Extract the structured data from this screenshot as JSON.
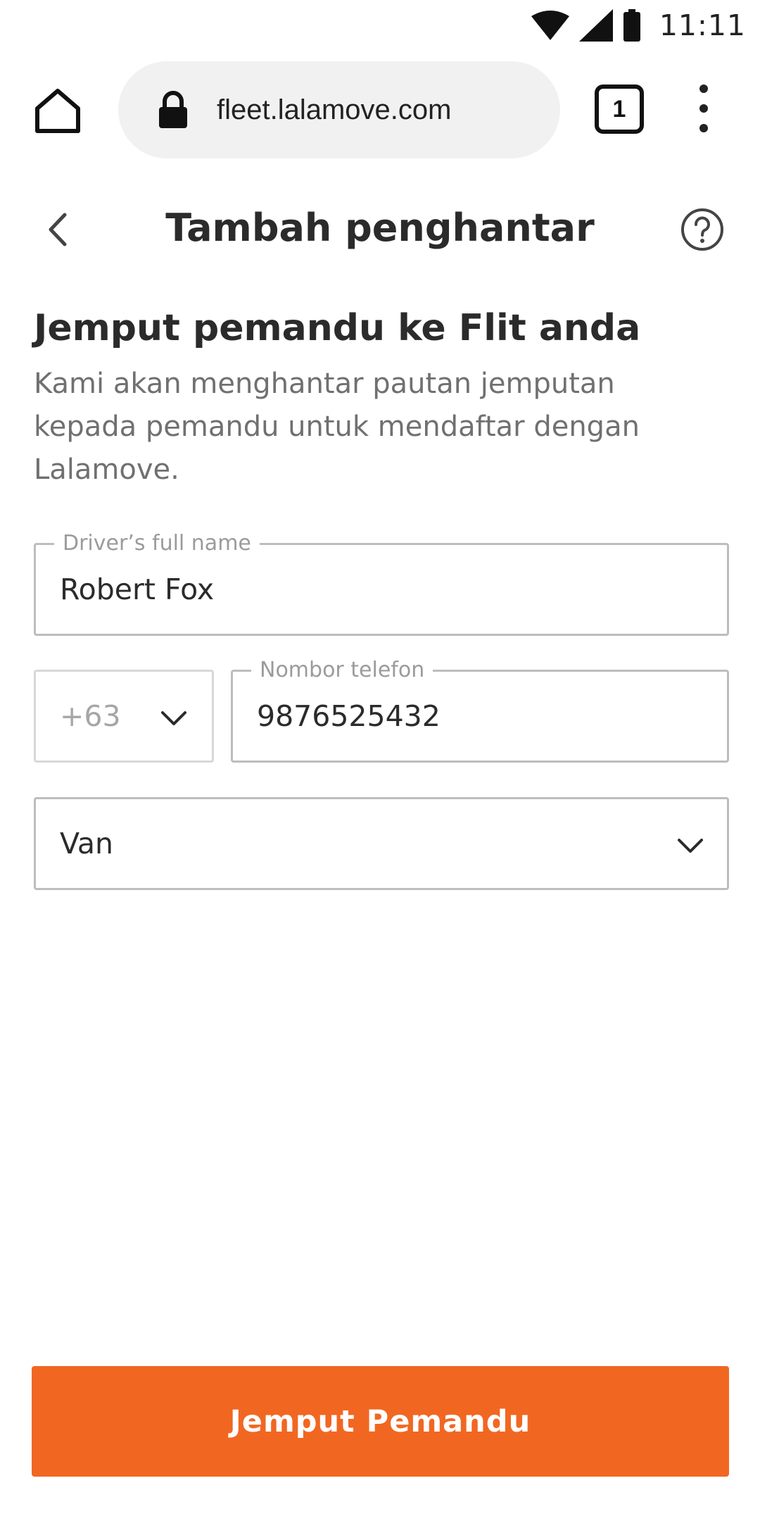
{
  "status_bar": {
    "time": "11:11",
    "icons": [
      "wifi-icon",
      "signal-icon",
      "battery-icon"
    ]
  },
  "browser": {
    "url": "fleet.lalamove.com",
    "tab_count": "1",
    "icons": [
      "home-icon",
      "lock-icon",
      "tabs-icon",
      "more-vert-icon"
    ]
  },
  "header": {
    "title": "Tambah penghantar",
    "icons": [
      "back-arrow-icon",
      "help-icon"
    ]
  },
  "content": {
    "heading": "Jemput pemandu ke Flit anda",
    "description": "Kami akan menghantar pautan jemputan kepada pemandu untuk mendaftar dengan Lalamove."
  },
  "form": {
    "name": {
      "label": "Driver’s full name",
      "value": "Robert Fox"
    },
    "country_code": {
      "value": "+63"
    },
    "phone": {
      "label": "Nombor telefon",
      "value": "9876525432"
    },
    "vehicle": {
      "value": "Van"
    }
  },
  "actions": {
    "submit_label": "Jemput Pemandu"
  },
  "colors": {
    "accent": "#f16722",
    "text_primary": "#2b2b2b",
    "text_secondary": "#707070",
    "field_border": "#bdbdbd",
    "url_bar_bg": "#f1f1f1"
  }
}
